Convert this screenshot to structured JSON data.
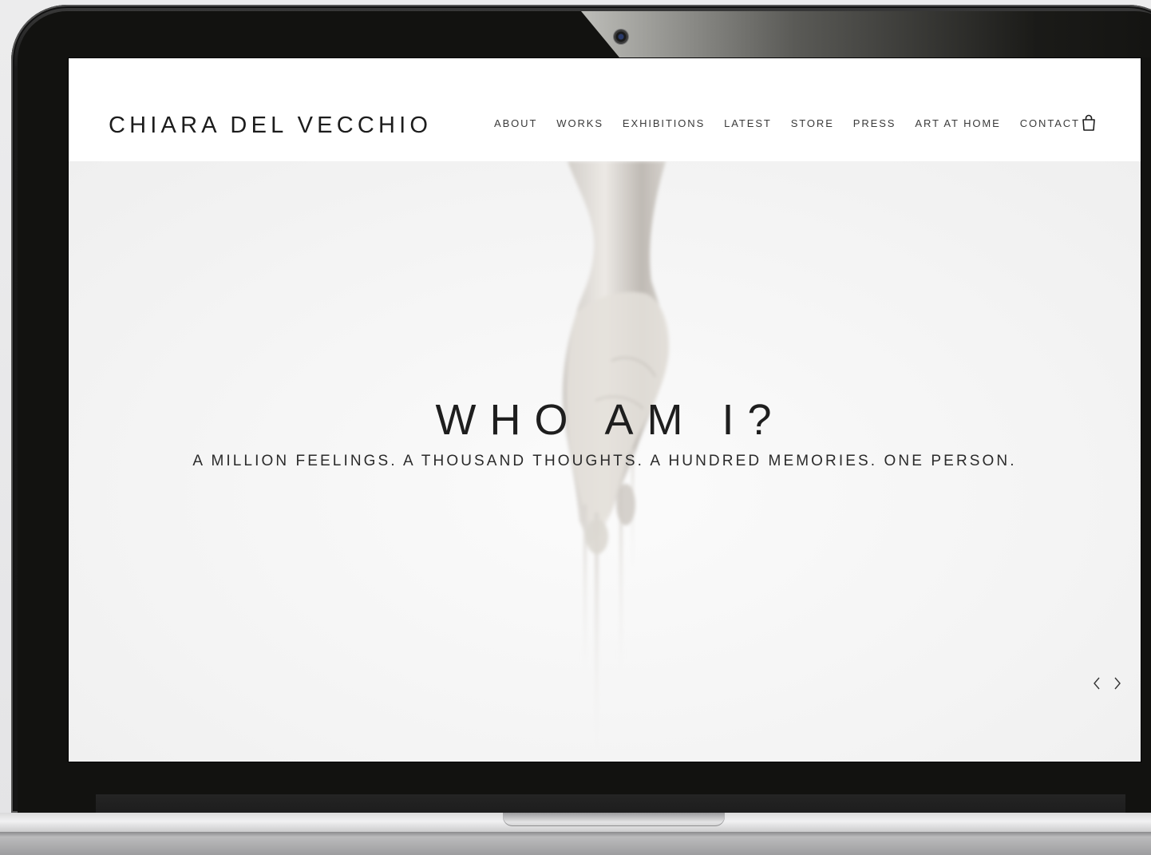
{
  "site": {
    "logo": "CHIARA DEL VECCHIO"
  },
  "nav": {
    "items": [
      {
        "label": "ABOUT"
      },
      {
        "label": "WORKS"
      },
      {
        "label": "EXHIBITIONS"
      },
      {
        "label": "LATEST"
      },
      {
        "label": "STORE"
      },
      {
        "label": "PRESS"
      },
      {
        "label": "ART AT HOME"
      },
      {
        "label": "CONTACT"
      }
    ],
    "cart_icon": "shopping-bag-icon"
  },
  "hero": {
    "title": "WHO AM I?",
    "subtitle": "A MILLION FEELINGS. A THOUSAND THOUGHTS. A HUNDRED MEMORIES. ONE PERSON.",
    "prev_icon": "chevron-left-icon",
    "next_icon": "chevron-right-icon"
  },
  "colors": {
    "header_bg": "#ffffff",
    "hero_bg": "#f4f4f4",
    "text": "#1e1e1e",
    "bezel": "#151515"
  }
}
